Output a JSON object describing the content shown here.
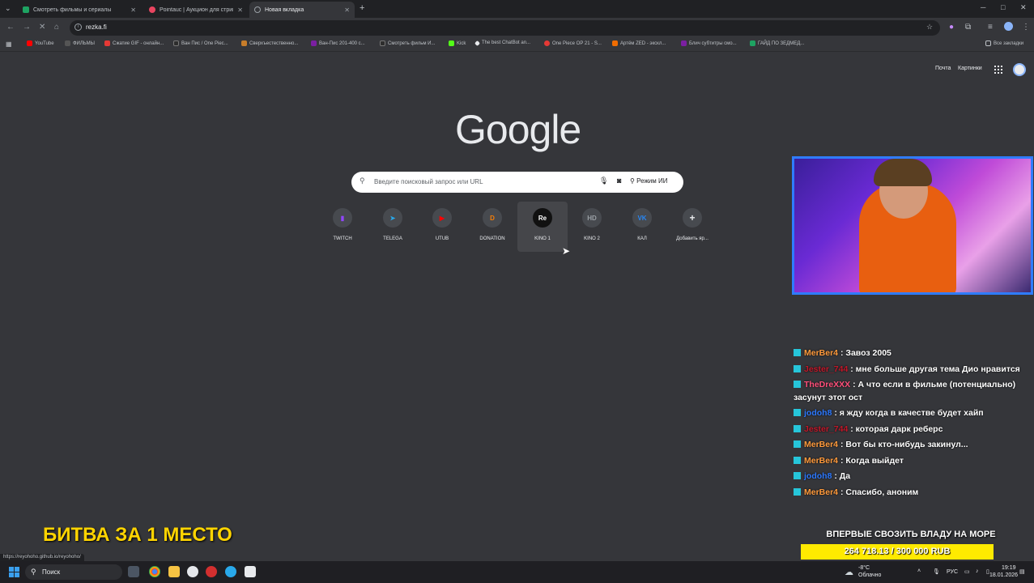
{
  "tabs": [
    {
      "title": "Смотреть фильмы и сериалы",
      "color": "#1ea362"
    },
    {
      "title": "Pointauc | Аукцион для стрима",
      "color": "#e94560"
    },
    {
      "title": "Новая вкладка",
      "color": "#9aa0a6"
    }
  ],
  "omnibox": {
    "url": "rezka.fi"
  },
  "bookmarks": [
    {
      "label": "YouTube",
      "color": "#ff0000"
    },
    {
      "label": "ФИЛЬМЫ",
      "color": "#555"
    },
    {
      "label": "Сжатие GIF - онлайн...",
      "color": "#e53935"
    },
    {
      "label": "Ван Пис / One Piec...",
      "color": "#2d2d2d"
    },
    {
      "label": "Сверхъестественно...",
      "color": "#c77d2a"
    },
    {
      "label": "Ван-Пис 201-400 с...",
      "color": "#7b1fa2"
    },
    {
      "label": "Смотреть фильм И...",
      "color": "#2d2d2d"
    },
    {
      "label": "Kick",
      "color": "#53fc18"
    },
    {
      "label": "The best ChatBot an...",
      "color": "#e8eaed"
    },
    {
      "label": "One Piece OP 21 - S...",
      "color": "#e53935"
    },
    {
      "label": "Артём ZED - экскл...",
      "color": "#ef6c00"
    },
    {
      "label": "Блич субтитры смо...",
      "color": "#7b1fa2"
    },
    {
      "label": "ГАЙД ПО ЗЕДМЕД...",
      "color": "#1ea362"
    }
  ],
  "all_bookmarks": "Все закладки",
  "header_links": {
    "mail": "Почта",
    "images": "Картинки"
  },
  "logo": "Google",
  "search": {
    "placeholder": "Введите поисковый запрос или URL",
    "ai_mode": "Режим ИИ"
  },
  "shortcuts": [
    {
      "label": "TWITCH",
      "glyph": "▮",
      "color": "#9146ff"
    },
    {
      "label": "TELEGA",
      "glyph": "➤",
      "color": "#29a9eb"
    },
    {
      "label": "UTUB",
      "glyph": "▶",
      "color": "#ff0000"
    },
    {
      "label": "DONATION",
      "glyph": "D",
      "color": "#f57d07"
    },
    {
      "label": "KINO 1",
      "glyph": "Re",
      "color": "#ffffff"
    },
    {
      "label": "KINO 2",
      "glyph": "HD",
      "color": "#9aa0a6"
    },
    {
      "label": "КАЛ",
      "glyph": "VK",
      "color": "#2787f5"
    },
    {
      "label": "Добавить яр...",
      "glyph": "+",
      "color": "#e8eaed"
    }
  ],
  "chat": [
    {
      "user": "MerBer4",
      "user_color": "#ff9a3c",
      "text": "Завоз 2005"
    },
    {
      "user": "Jester_744",
      "user_color": "#c0182a",
      "text": "мне больше другая тема Дио нравится"
    },
    {
      "user": "TheDreXXX",
      "user_color": "#ff4f7a",
      "text": "А что если в фильме (потенциально) засунут этот ост"
    },
    {
      "user": "jodoh8",
      "user_color": "#2d79ff",
      "text": "я жду когда в качестве будет хайп"
    },
    {
      "user": "Jester_744",
      "user_color": "#c0182a",
      "text": "которая дарк реберс"
    },
    {
      "user": "MerBer4",
      "user_color": "#ff9a3c",
      "text": "Вот бы кто-нибудь закинул..."
    },
    {
      "user": "MerBer4",
      "user_color": "#ff9a3c",
      "text": "Когда выйдет"
    },
    {
      "user": "jodoh8",
      "user_color": "#2d79ff",
      "text": "Да"
    },
    {
      "user": "MerBer4",
      "user_color": "#ff9a3c",
      "text": "Спасибо, аноним"
    }
  ],
  "overlay_title": "БИТВА ЗА 1 МЕСТО",
  "goal": {
    "title": "ВПЕРВЫЕ СВОЗИТЬ ВЛАДУ НА МОРЕ",
    "amount": "264 718.13 / 300 000 RUB",
    "progress": 0.8824
  },
  "status_url": "https://reyohoho.github.io/reyohoho/",
  "taskbar": {
    "search": "Поиск",
    "weather_temp": "-8°C",
    "weather_desc": "Облачно",
    "lang": "РУС",
    "time": "19:19",
    "date": "18.01.2026"
  }
}
